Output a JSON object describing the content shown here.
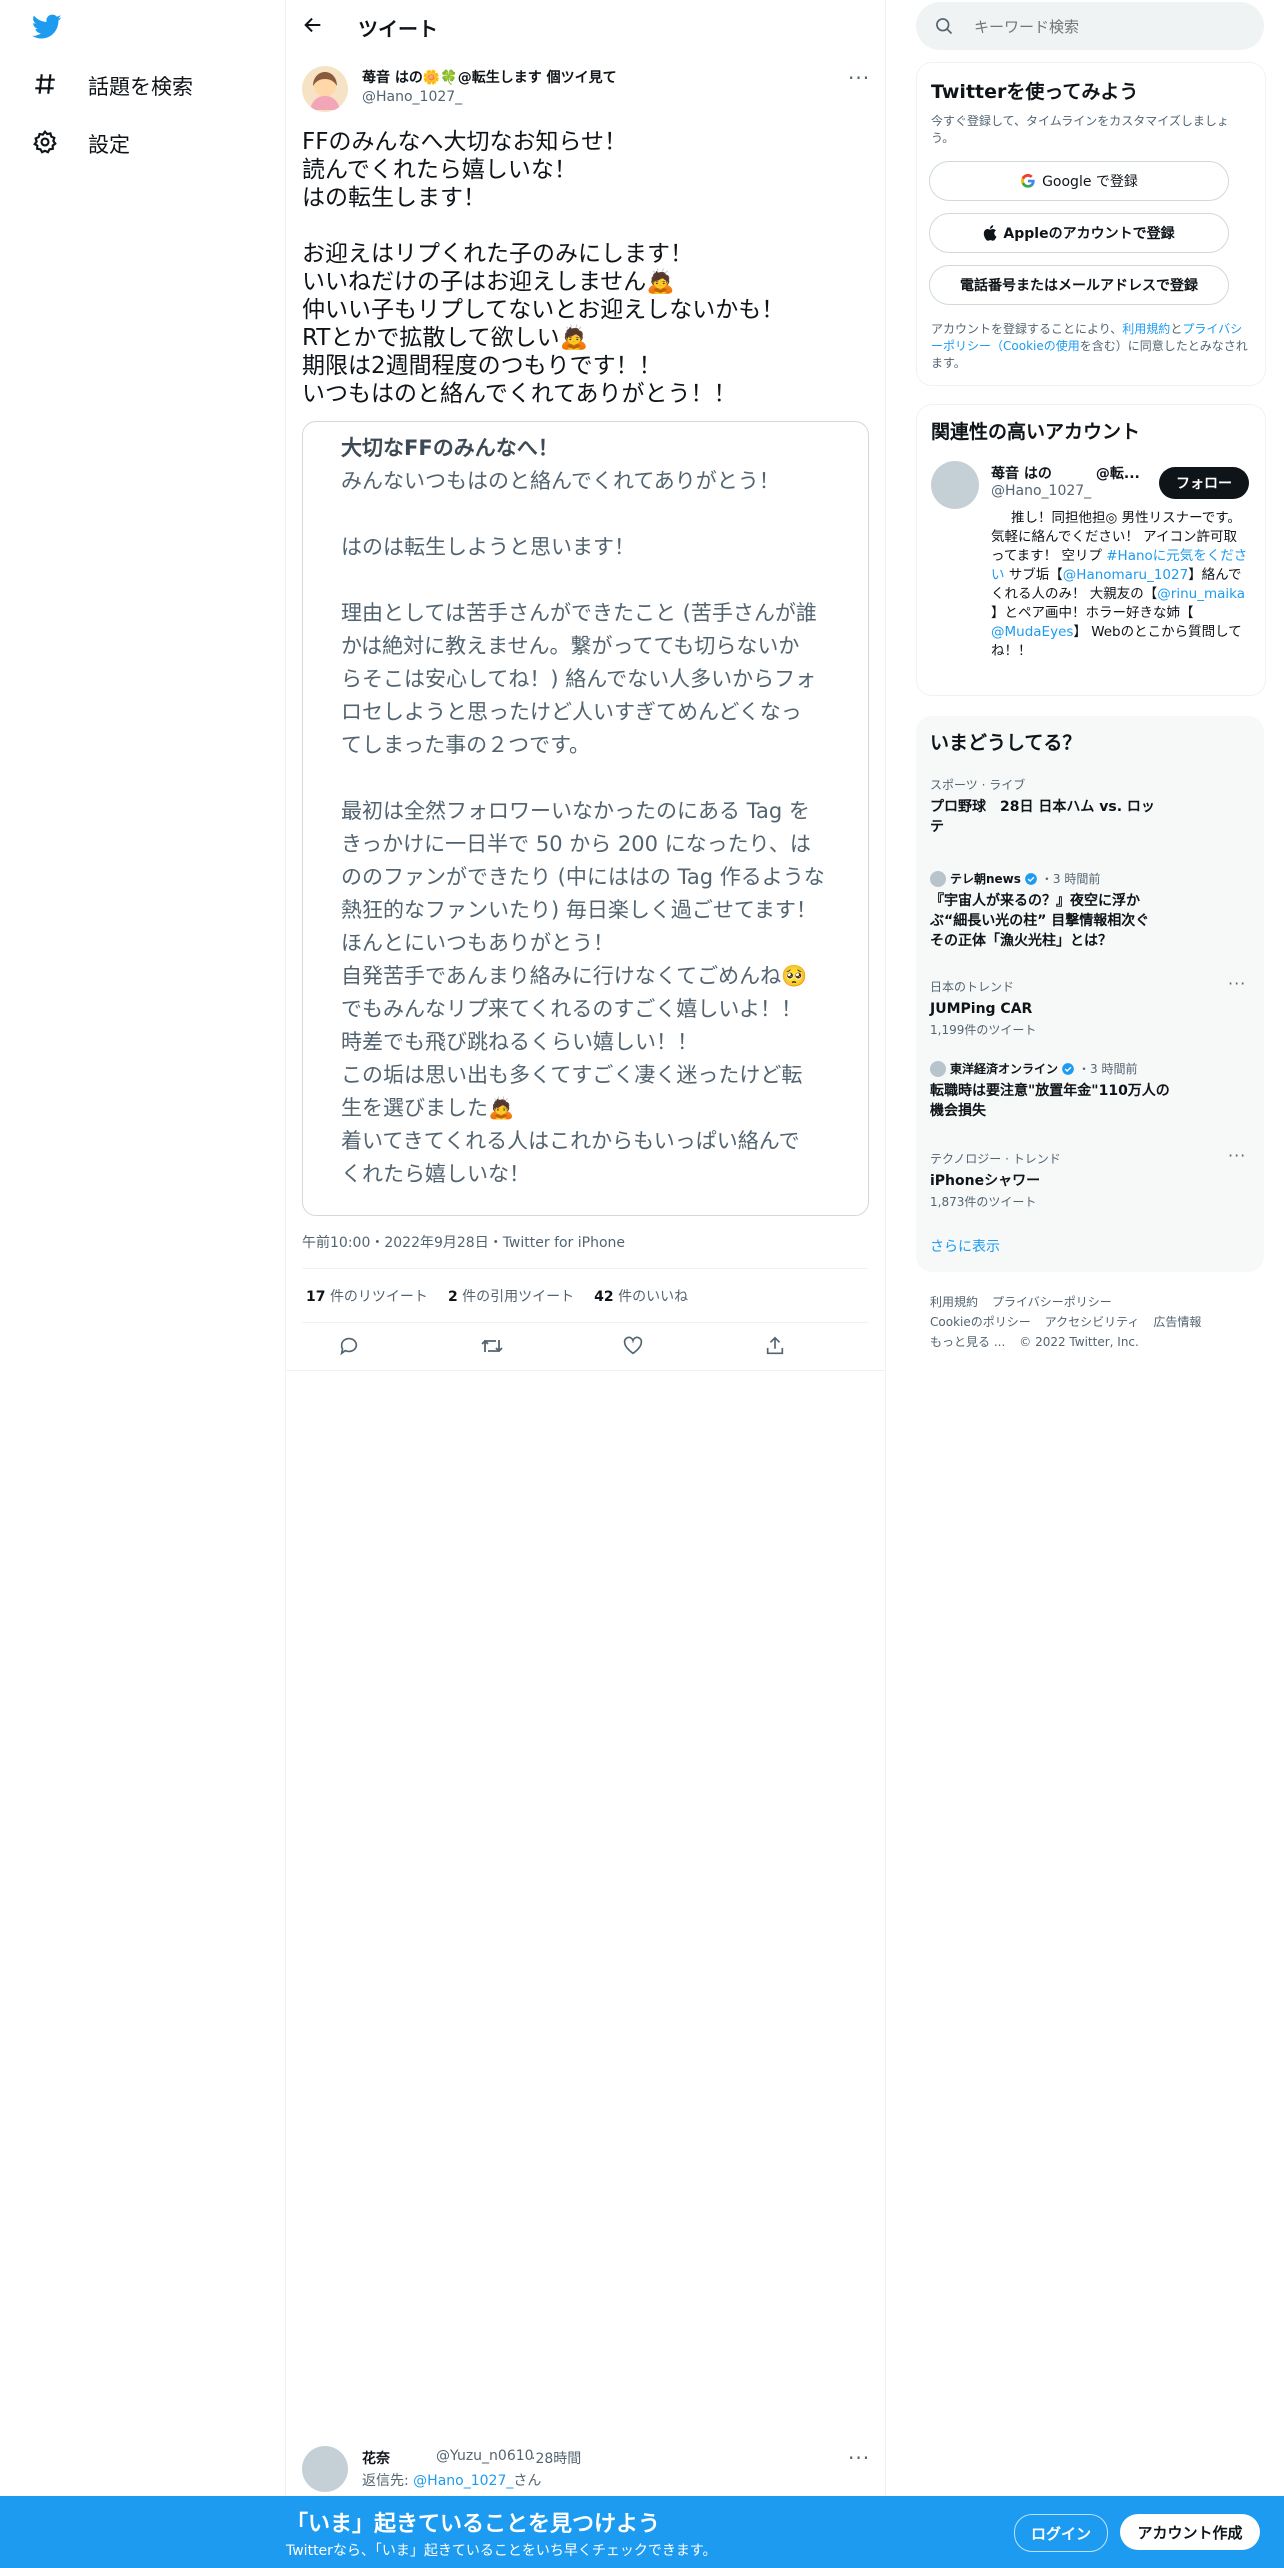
{
  "nav": {
    "logo": "twitter-bird",
    "items": [
      {
        "label": "話題を検索",
        "icon": "hashtag-icon"
      },
      {
        "label": "設定",
        "icon": "gear-icon"
      }
    ]
  },
  "header": {
    "title": "ツイート"
  },
  "tweet": {
    "display_name": "苺音 はの🌼🍀@転生します 個ツイ見て",
    "handle": "@Hano_1027_",
    "lines": [
      "FFのみんなへ大切なお知らせ！",
      "読んでくれたら嬉しいな！",
      "はの転生します！",
      "",
      "お迎えはリプくれた子のみにします！",
      "いいねだけの子はお迎えしません🙇",
      "仲いい子もリプしてないとお迎えしないかも！",
      "RTとかで拡散して欲しい🙇",
      "期限は2週間程度のつもりです！！",
      "いつもはのと絡んでくれてありがとう！！"
    ],
    "card": {
      "title": "大切なFFのみんなへ！",
      "lines": [
        "みんないつもはのと絡んでくれてありがとう！",
        "",
        "はのは転生しようと思います！",
        "",
        "理由としては苦手さんができたこと (苦手さんが誰",
        "かは絶対に教えません。繋がってても切らないか",
        "らそこは安心してね！) 絡んでない人多いからフォ",
        "ロセしようと思ったけど人いすぎてめんどくなっ",
        "てしまった事の２つです。",
        "",
        "最初は全然フォロワーいなかったのにある Tag を",
        "きっかけに一日半で 50 から 200 になったり、は",
        "ののファンができたり (中にははの Tag 作るような",
        "熱狂的なファンいたり) 毎日楽しく過ごせてます！",
        "ほんとにいつもありがとう！",
        "自発苦手であんまり絡みに行けなくてごめんね🥺",
        "でもみんなリプ来てくれるのすごく嬉しいよ！！",
        "時差でも飛び跳ねるくらい嬉しい！！",
        "この垢は思い出も多くてすごく凄く迷ったけど転",
        "生を選びました🙇",
        "着いてきてくれる人はこれからもいっぱい絡んで",
        "くれたら嬉しいな！"
      ]
    },
    "timestamp": "午前10:00・2022年9月28日・Twitter for iPhone",
    "stats": {
      "retweets": "17",
      "retweets_label": "件のリツイート",
      "quotes": "2",
      "quotes_label": "件の引用ツイート",
      "likes": "42",
      "likes_label": "件のいいね"
    },
    "actions": [
      "reply-icon",
      "retweet-icon",
      "like-icon",
      "share-icon"
    ]
  },
  "reply": {
    "name": "花奈",
    "handle": "@Yuzu_n0610",
    "time": "28時間",
    "reply_to_prefix": "返信先: ",
    "reply_to_handle": "@Hano_1027_",
    "reply_to_suffix": "さん"
  },
  "search": {
    "placeholder": "キーワード検索"
  },
  "signup": {
    "title": "Twitterを使ってみよう",
    "subtitle": "今すぐ登録して、タイムラインをカスタマイズしましょう。",
    "google": "Google で登録",
    "apple": "Appleのアカウントで登録",
    "phone": "電話番号またはメールアドレスで登録",
    "terms_prefix": "アカウントを登録することにより、",
    "terms_link1": "利用規約",
    "terms_and": "と",
    "terms_link2": "プライバシーポリシー（Cookieの使用",
    "terms_suffix": "を含む）に同意したとみなされます。"
  },
  "related": {
    "title": "関連性の高いアカウント",
    "name": "苺音 はの",
    "name_suffix": "@転...",
    "handle": "@Hano_1027_",
    "follow": "フォロー",
    "bio": [
      {
        "t": "推し！同担他担◎ 男性リスナーです。気軽に絡んでください！ アイコン許可取ってます！ 空リプ ",
        "link": false
      },
      {
        "t": "#Hanoに元気をください",
        "link": true
      },
      {
        "t": " サブ垢【",
        "link": false
      },
      {
        "t": "@Hanomaru_1027",
        "link": true
      },
      {
        "t": "】絡んでくれる人のみ！ 大親友の【",
        "link": false
      },
      {
        "t": "@rinu_maika",
        "link": true
      },
      {
        "t": " 】とペア画中！ホラー好きな姉【 ",
        "link": false
      },
      {
        "t": "@MudaEyes",
        "link": true
      },
      {
        "t": "】 Webのとこから質問してね！！",
        "link": false
      }
    ]
  },
  "trends": {
    "title": "いまどうしてる？",
    "t1_meta": "スポーツ · ライブ",
    "t1_title": "プロ野球　28日 日本ハム vs. ロッテ",
    "t2_source": "テレ朝news",
    "t2_time": "・3 時間前",
    "t2_title": "『宇宙人が来るの？』夜空に浮かぶ“細長い光の柱” 目撃情報相次ぐ　その正体「漁火光柱」とは？",
    "t3_meta": "日本のトレンド",
    "t3_title": "JUMPing CAR",
    "t3_count": "1,199件のツイート",
    "t4_source": "東洋経済オンライン",
    "t4_time": "・3 時間前",
    "t4_title": "転職時は要注意\"放置年金\"110万人の機会損失",
    "t5_meta": "テクノロジー · トレンド",
    "t5_title": "iPhoneシャワー",
    "t5_count": "1,873件のツイート",
    "more": "さらに表示"
  },
  "footer": {
    "links": [
      "利用規約",
      "プライバシーポリシー",
      "Cookieのポリシー",
      "アクセシビリティ",
      "広告情報",
      "もっと見る ..."
    ],
    "copyright": "© 2022 Twitter, Inc."
  },
  "banner": {
    "title": "「いま」起きていることを見つけよう",
    "subtitle": "Twitterなら、「いま」起きていることをいち早くチェックできます。",
    "login": "ログイン",
    "signup": "アカウント作成"
  },
  "colors": {
    "accent": "#1d9bf0",
    "text": "#0f1419",
    "muted": "#536471",
    "panel": "#f7f9f9"
  }
}
